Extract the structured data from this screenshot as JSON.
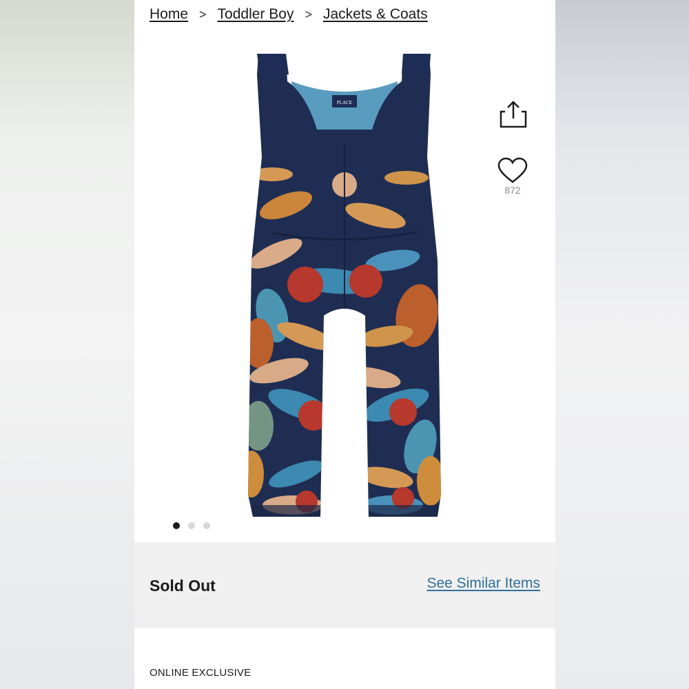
{
  "breadcrumb": {
    "items": [
      {
        "label": "Home"
      },
      {
        "label": "Toddler Boy"
      },
      {
        "label": "Jackets & Coats"
      }
    ],
    "separator": ">"
  },
  "product": {
    "image_icon": "dinosaur-print-snow-overalls",
    "brand_label": "PLACE",
    "favorites_count": "872",
    "carousel": {
      "count": 3,
      "active_index": 0
    }
  },
  "actions": {
    "share_icon": "share-icon",
    "favorite_icon": "heart-icon"
  },
  "status": {
    "availability": "Sold Out",
    "similar_link": "See Similar Items"
  },
  "details": {
    "badge": "ONLINE EXCLUSIVE"
  },
  "colors": {
    "link": "#2f6e9b",
    "fabric_navy": "#1f2d52",
    "lining_blue": "#4f8fb3"
  }
}
